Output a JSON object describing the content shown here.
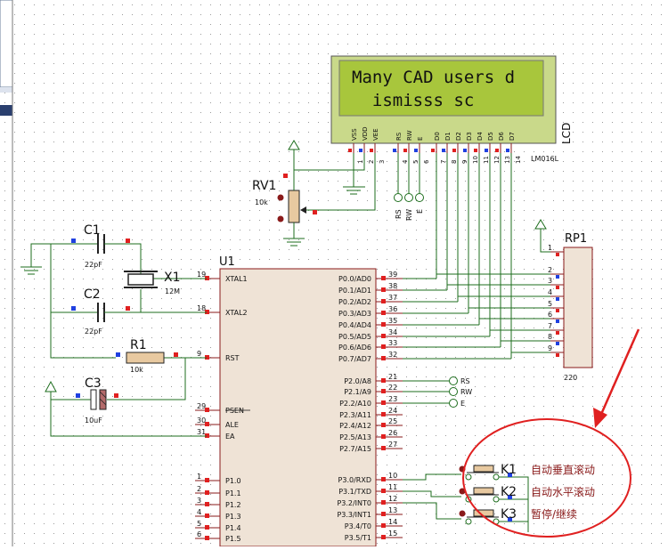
{
  "lcd": {
    "line1": "Many CAD users d",
    "line2": "  ismisss sc",
    "ref": "LCD",
    "model": "LM016L",
    "pins": [
      "VSS",
      "VDD",
      "VEE",
      "RS",
      "RW",
      "E",
      "D0",
      "D1",
      "D2",
      "D3",
      "D4",
      "D5",
      "D6",
      "D7"
    ],
    "pin_numbers": [
      "1",
      "2",
      "3",
      "4",
      "5",
      "6",
      "7",
      "8",
      "9",
      "10",
      "11",
      "12",
      "13",
      "14"
    ],
    "ctrl_terms": [
      "RS",
      "RW",
      "E"
    ]
  },
  "rv1": {
    "ref": "RV1",
    "value": "10k"
  },
  "crystal": {
    "ref": "X1",
    "value": "12M"
  },
  "c1": {
    "ref": "C1",
    "value": "22pF"
  },
  "c2": {
    "ref": "C2",
    "value": "22pF"
  },
  "c3": {
    "ref": "C3",
    "value": "10uF"
  },
  "r1": {
    "ref": "R1",
    "value": "10k"
  },
  "rp1": {
    "ref": "RP1",
    "value": "220",
    "pins": [
      "1",
      "2",
      "3",
      "4",
      "5",
      "6",
      "7",
      "8",
      "9"
    ]
  },
  "u1": {
    "ref": "U1",
    "left_pins": [
      {
        "num": "19",
        "name": "XTAL1"
      },
      {
        "num": "18",
        "name": "XTAL2"
      },
      {
        "num": "9",
        "name": "RST"
      },
      {
        "num": "29",
        "name": "PSEN"
      },
      {
        "num": "30",
        "name": "ALE"
      },
      {
        "num": "31",
        "name": "EA"
      },
      {
        "num": "1",
        "name": "P1.0"
      },
      {
        "num": "2",
        "name": "P1.1"
      },
      {
        "num": "3",
        "name": "P1.2"
      },
      {
        "num": "4",
        "name": "P1.3"
      },
      {
        "num": "5",
        "name": "P1.4"
      },
      {
        "num": "6",
        "name": "P1.5"
      }
    ],
    "right_pins": [
      {
        "num": "39",
        "name": "P0.0/AD0"
      },
      {
        "num": "38",
        "name": "P0.1/AD1"
      },
      {
        "num": "37",
        "name": "P0.2/AD2"
      },
      {
        "num": "36",
        "name": "P0.3/AD3"
      },
      {
        "num": "35",
        "name": "P0.4/AD4"
      },
      {
        "num": "34",
        "name": "P0.5/AD5"
      },
      {
        "num": "33",
        "name": "P0.6/AD6"
      },
      {
        "num": "32",
        "name": "P0.7/AD7"
      },
      {
        "num": "21",
        "name": "P2.0/A8"
      },
      {
        "num": "22",
        "name": "P2.1/A9"
      },
      {
        "num": "23",
        "name": "P2.2/A10"
      },
      {
        "num": "24",
        "name": "P2.3/A11"
      },
      {
        "num": "25",
        "name": "P2.4/A12"
      },
      {
        "num": "26",
        "name": "P2.5/A13"
      },
      {
        "num": "27",
        "name": "P2.7/A15"
      },
      {
        "num": "10",
        "name": "P3.0/RXD"
      },
      {
        "num": "11",
        "name": "P3.1/TXD"
      },
      {
        "num": "12",
        "name": "P3.2/INT0"
      },
      {
        "num": "13",
        "name": "P3.3/INT1"
      },
      {
        "num": "14",
        "name": "P3.4/T0"
      },
      {
        "num": "15",
        "name": "P3.5/T1"
      }
    ],
    "p2_terms": [
      "RS",
      "RW",
      "E"
    ]
  },
  "keys": [
    {
      "ref": "K1",
      "label": "自动垂直滚动"
    },
    {
      "ref": "K2",
      "label": "自动水平滚动"
    },
    {
      "ref": "K3",
      "label": "暂停/继续"
    }
  ],
  "colors": {
    "wire": "#1e6e1e",
    "comp": "#8a1a1a",
    "chip_fill": "#efe3d6",
    "lcd_fill": "#c9d98a",
    "lcd_screen": "#a8c63c",
    "pin_red": "#e02020",
    "pin_blue": "#2040e0",
    "annot": "#e02020"
  }
}
